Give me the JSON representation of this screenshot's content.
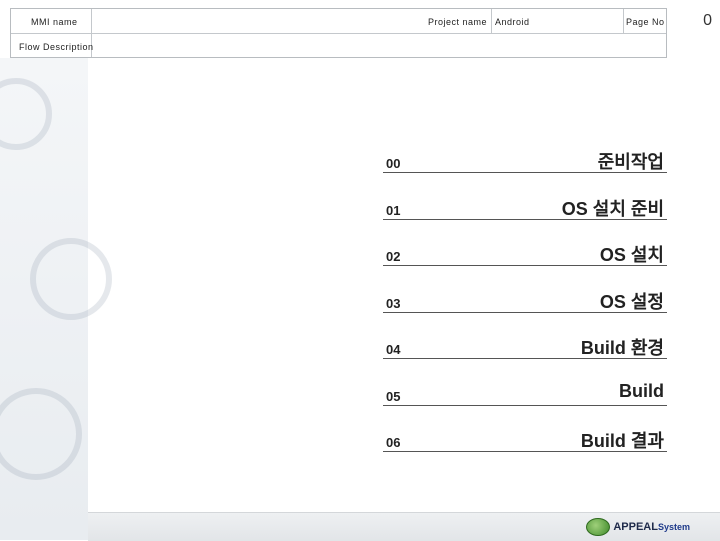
{
  "header": {
    "mmi_label": "MMI name",
    "mmi_value": "",
    "project_label": "Project name",
    "project_value": "Android",
    "page_label": "Page No",
    "page_value": "0",
    "flow_label": "Flow Description"
  },
  "toc": [
    {
      "num": "00",
      "title": "준비작업"
    },
    {
      "num": "01",
      "title": "OS 설치 준비"
    },
    {
      "num": "02",
      "title": "OS 설치"
    },
    {
      "num": "03",
      "title": "OS 설정"
    },
    {
      "num": "04",
      "title": "Build 환경"
    },
    {
      "num": "05",
      "title": "Build"
    },
    {
      "num": "06",
      "title": "Build 결과"
    }
  ],
  "footer": {
    "logo_brand": "APPEAL",
    "logo_suffix": "System"
  }
}
